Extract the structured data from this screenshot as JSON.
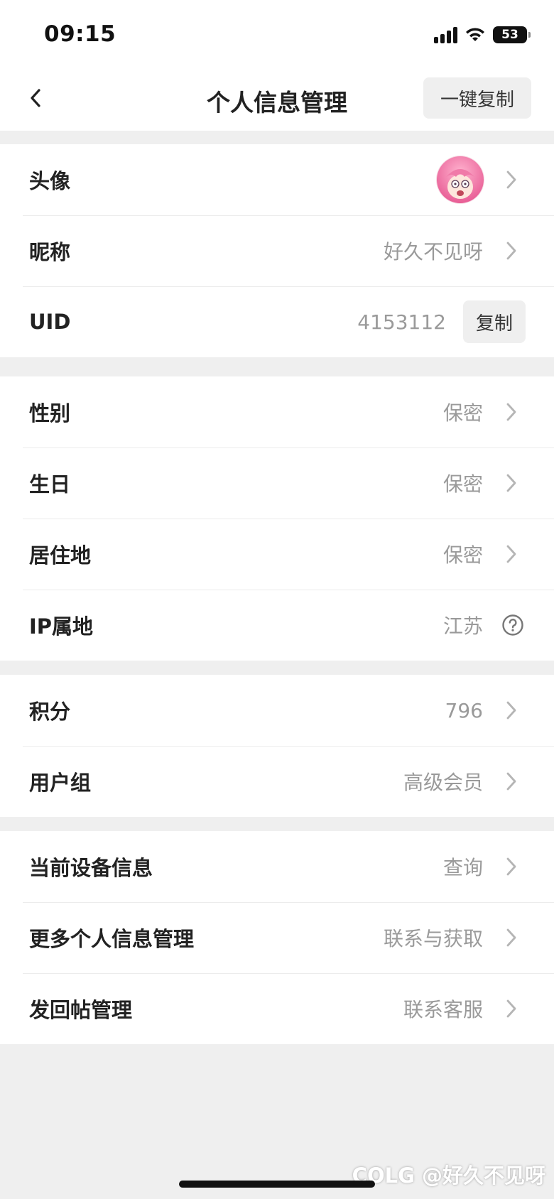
{
  "status_bar": {
    "time": "09:15",
    "battery": "53",
    "icons": [
      "signal-icon",
      "wifi-icon",
      "battery-icon"
    ]
  },
  "nav": {
    "title": "个人信息管理",
    "copy_all_label": "一键复制",
    "back_icon": "chevron-left-icon"
  },
  "groups": {
    "basic": {
      "avatar_label": "头像",
      "nickname_label": "昵称",
      "nickname_value": "好久不见呀",
      "uid_label": "UID",
      "uid_value": "4153112",
      "uid_copy_label": "复制"
    },
    "profile": {
      "gender_label": "性别",
      "gender_value": "保密",
      "birthday_label": "生日",
      "birthday_value": "保密",
      "residence_label": "居住地",
      "residence_value": "保密",
      "ip_label": "IP属地",
      "ip_value": "江苏"
    },
    "account": {
      "points_label": "积分",
      "points_value": "796",
      "usergroup_label": "用户组",
      "usergroup_value": "高级会员"
    },
    "more": {
      "device_label": "当前设备信息",
      "device_value": "查询",
      "more_info_label": "更多个人信息管理",
      "more_info_value": "联系与获取",
      "post_label": "发回帖管理",
      "post_value": "联系客服"
    }
  },
  "watermark": "COLG @好久不见呀",
  "colors": {
    "background": "#efefef",
    "surface": "#ffffff",
    "label": "#222222",
    "value": "#9a9a9a",
    "chevron": "#b5b5b5"
  }
}
